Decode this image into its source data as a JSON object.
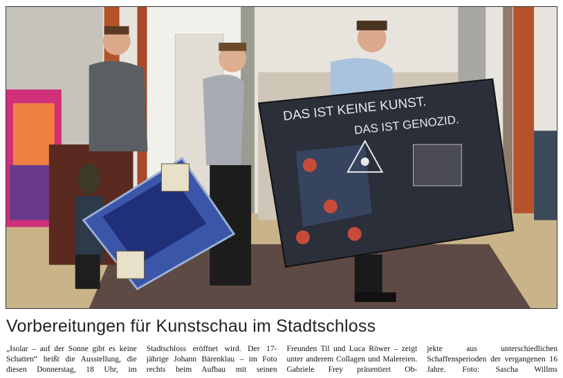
{
  "headline": "Vorbereitungen für Kunstschau im Stadtschloss",
  "photo": {
    "painting_text_line1": "DAS IST KEINE KUNST.",
    "painting_text_line2": "DAS IST GENOZID."
  },
  "columns": [
    "„Isolar – auf der Sonne gibt es keine Schatten“ heißt die Ausstellung, die diesen Donnerstag, 18 Uhr, im",
    "Stadtschloss eröffnet wird. Der 17-jährige Johann Bärenklau – im Foto rechts beim Aufbau mit seinen",
    "Freunden Til und Luca Röwer – zeigt unter anderem Collagen und Malereien. Gabriele Frey präsentiert Ob-",
    "jekte aus unterschiedlichen Schaffensperioden der vergangenen 16 Jahre.   Foto: Sascha Willms"
  ],
  "colors": {
    "floor": "#c9b48a",
    "carpet": "#5e4a44",
    "wall": "#e9e6df",
    "pillar": "#b4532a",
    "big_painting": "#2b2f3a",
    "blue_painting": "#3b56a8"
  }
}
